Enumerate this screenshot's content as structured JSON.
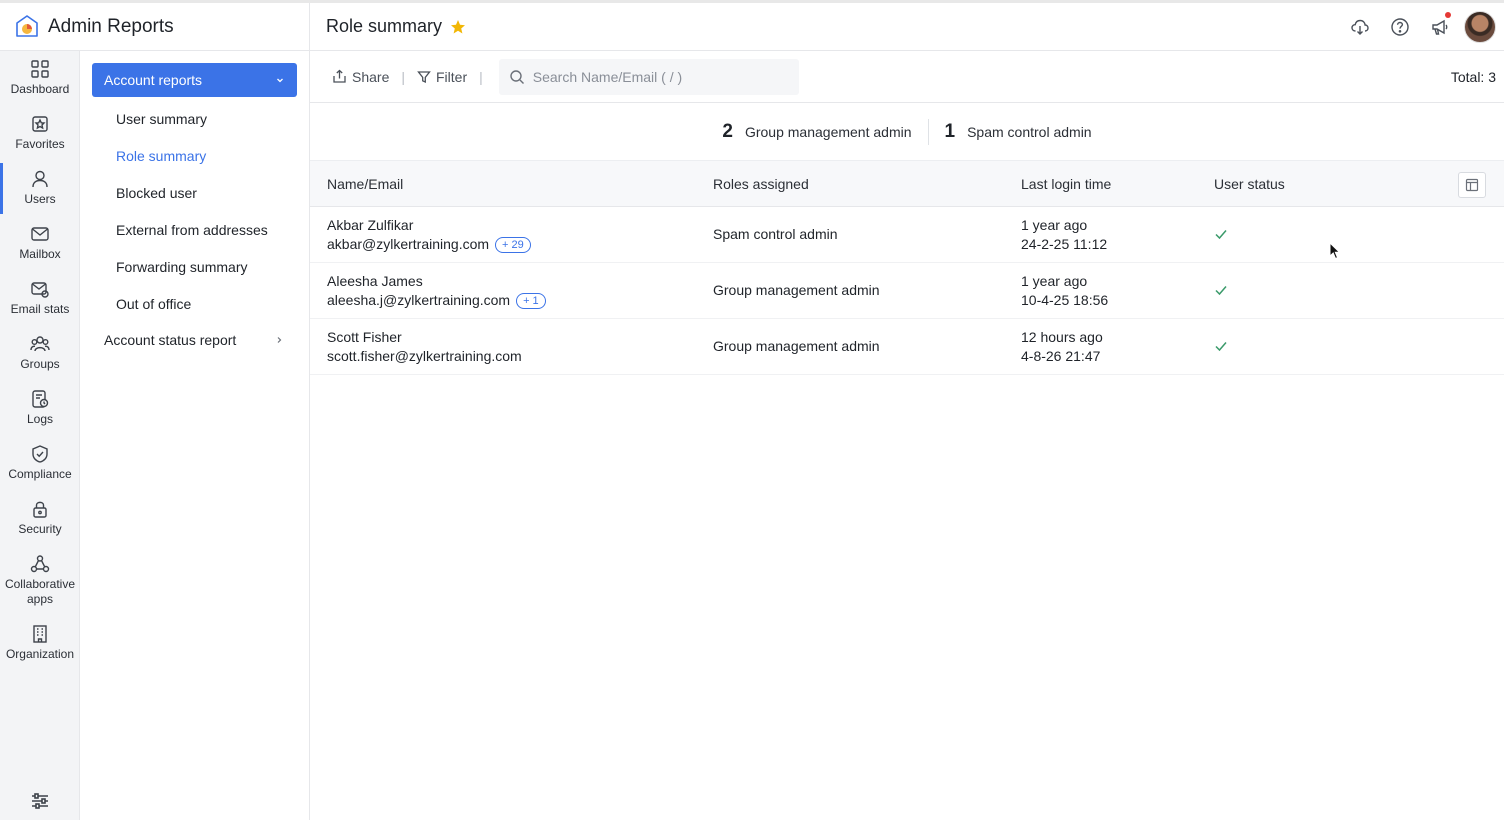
{
  "app": {
    "title": "Admin Reports"
  },
  "page": {
    "title": "Role summary"
  },
  "rail": [
    {
      "label": "Dashboard",
      "icon": "dashboard-icon"
    },
    {
      "label": "Favorites",
      "icon": "favorites-icon"
    },
    {
      "label": "Users",
      "icon": "user-icon"
    },
    {
      "label": "Mailbox",
      "icon": "mailbox-icon"
    },
    {
      "label": "Email stats",
      "icon": "email-stats-icon"
    },
    {
      "label": "Groups",
      "icon": "groups-icon"
    },
    {
      "label": "Logs",
      "icon": "logs-icon"
    },
    {
      "label": "Compliance",
      "icon": "compliance-icon"
    },
    {
      "label": "Security",
      "icon": "lock-icon"
    },
    {
      "label": "Collaborative apps",
      "icon": "collaborative-apps-icon"
    },
    {
      "label": "Organization",
      "icon": "organization-icon"
    }
  ],
  "subnav": {
    "group_label": "Account reports",
    "items": [
      "User summary",
      "Role summary",
      "Blocked user",
      "External from addresses",
      "Forwarding summary",
      "Out of office"
    ],
    "group2_label": "Account status report"
  },
  "toolbar": {
    "share_label": "Share",
    "filter_label": "Filter",
    "search_placeholder": "Search Name/Email ( / )",
    "total_label": "Total: 3"
  },
  "summary": [
    {
      "count": "2",
      "label": "Group management admin"
    },
    {
      "count": "1",
      "label": "Spam control admin"
    }
  ],
  "table": {
    "headers": {
      "name": "Name/Email",
      "roles": "Roles assigned",
      "last_login": "Last login time",
      "status": "User status"
    },
    "rows": [
      {
        "name": "Akbar Zulfikar",
        "email": "akbar@zylkertraining.com",
        "badge": "+ 29",
        "role": "Spam control admin",
        "login_relative": "1 year ago",
        "login_time": "24-2-25 11:12"
      },
      {
        "name": "Aleesha James",
        "email": "aleesha.j@zylkertraining.com",
        "badge": "+ 1",
        "role": "Group management admin",
        "login_relative": "1 year ago",
        "login_time": "10-4-25 18:56"
      },
      {
        "name": "Scott Fisher",
        "email": "scott.fisher@zylkertraining.com",
        "badge": "",
        "role": "Group management admin",
        "login_relative": "12 hours ago",
        "login_time": "4-8-26 21:47"
      }
    ]
  },
  "colors": {
    "accent": "#3b73e7",
    "check": "#3a9a6a",
    "star": "#f2b705"
  }
}
